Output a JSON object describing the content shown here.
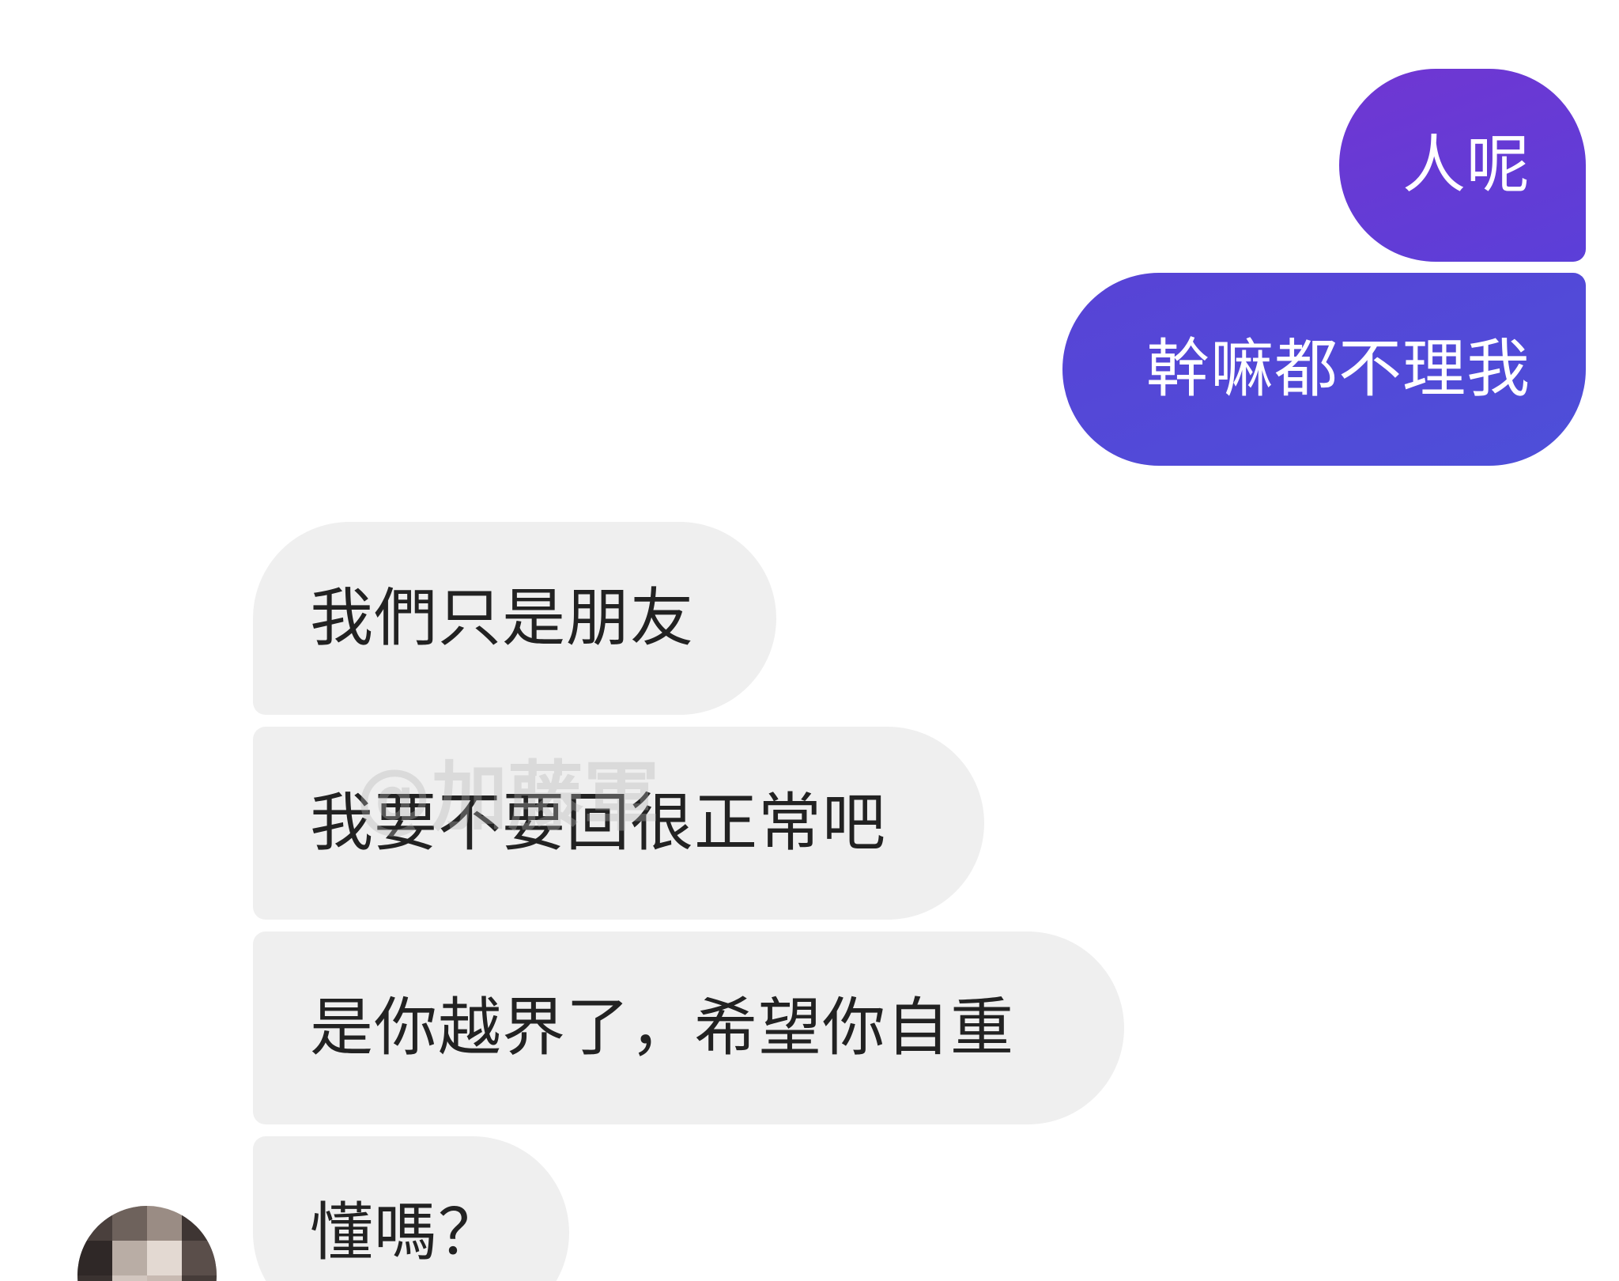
{
  "chat": {
    "outgoing": [
      {
        "text": "人呢"
      },
      {
        "text": "幹嘛都不理我"
      }
    ],
    "incoming": [
      {
        "text": "我們只是朋友"
      },
      {
        "text": "我要不要回很正常吧"
      },
      {
        "text": "是你越界了，希望你自重"
      },
      {
        "text": "懂嗎？"
      }
    ]
  },
  "watermark": "@加藤軍",
  "colors": {
    "outgoing_bubble": "#5b3fd8",
    "incoming_bubble": "#efefef",
    "outgoing_text": "#ffffff",
    "incoming_text": "#222222"
  },
  "avatar": {
    "icon": "pixelated-avatar-icon"
  }
}
